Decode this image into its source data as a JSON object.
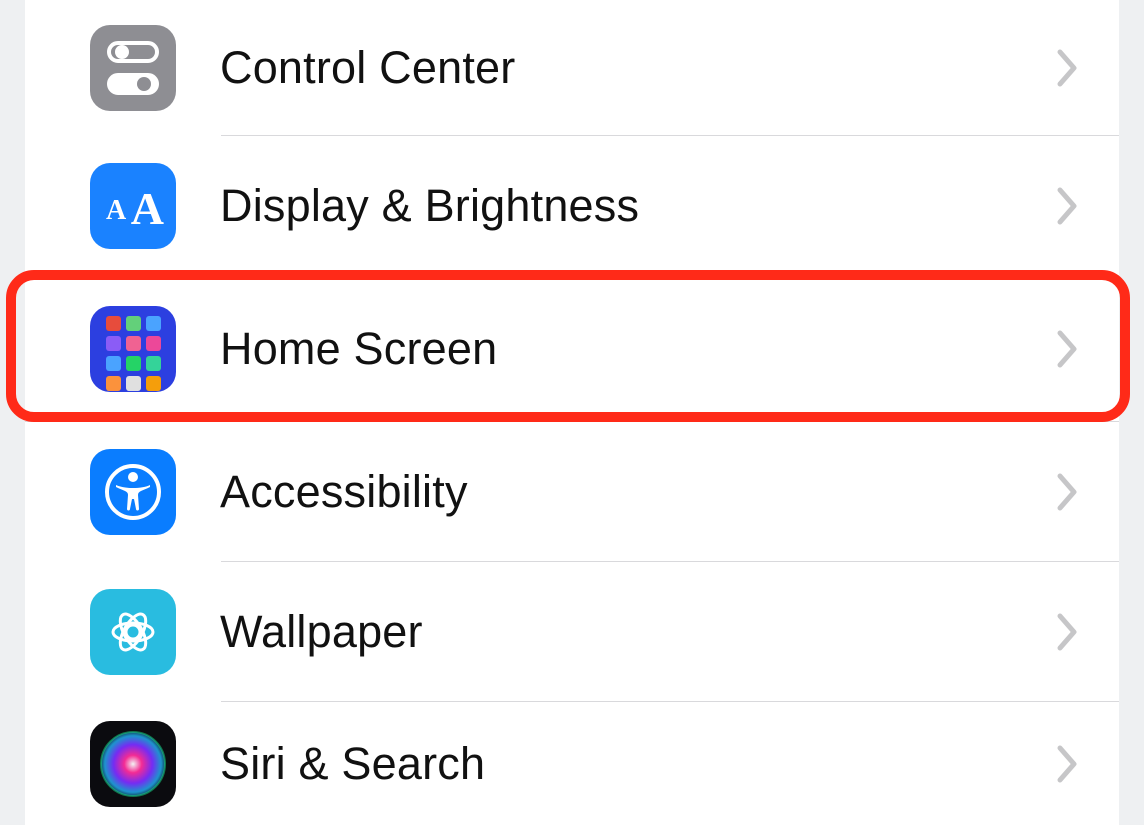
{
  "settings": {
    "items": [
      {
        "key": "control-center",
        "label": "Control Center"
      },
      {
        "key": "display-brightness",
        "label": "Display & Brightness"
      },
      {
        "key": "home-screen",
        "label": "Home Screen"
      },
      {
        "key": "accessibility",
        "label": "Accessibility"
      },
      {
        "key": "wallpaper",
        "label": "Wallpaper"
      },
      {
        "key": "siri-search",
        "label": "Siri & Search"
      }
    ],
    "highlighted_key": "home-screen"
  },
  "home_screen_icon_colors": [
    "#e74c3c",
    "#63d07a",
    "#4aa3ff",
    "#8b5cf6",
    "#f06292",
    "#ec4899",
    "#4aa3ff",
    "#25d366",
    "#34d399",
    "#fb923c",
    "#e0e0e0",
    "#f59e0b"
  ]
}
